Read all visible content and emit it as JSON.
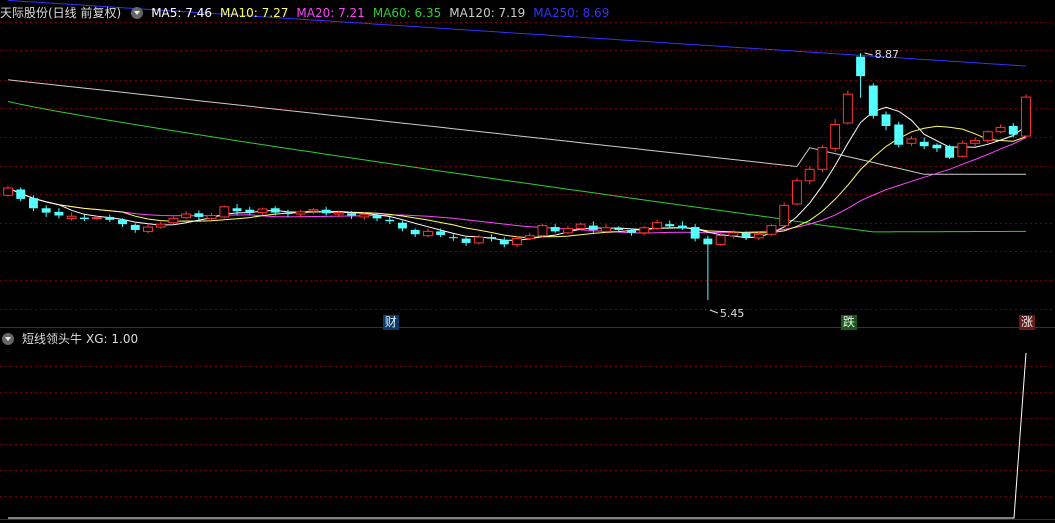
{
  "header": {
    "title": "天际股份(日线 前复权)",
    "ma": [
      {
        "label": "MA5: 7.46",
        "color": "#ffffff"
      },
      {
        "label": "MA10: 7.27",
        "color": "#ffff66"
      },
      {
        "label": "MA20: 7.21",
        "color": "#ff44ff"
      },
      {
        "label": "MA60: 6.35",
        "color": "#33cc33"
      },
      {
        "label": "MA120: 7.19",
        "color": "#cccccc"
      },
      {
        "label": "MA250: 8.69",
        "color": "#3333ff"
      }
    ]
  },
  "indicator": {
    "title": "短线领头牛",
    "value_label": "XG: 1.00"
  },
  "colors": {
    "up": "#ff3333",
    "down": "#54ffff",
    "grid": "#7a0000",
    "background": "#000000",
    "ma5": "#ffffff",
    "ma10": "#ffff66",
    "ma20": "#ff44ff",
    "ma60": "#33cc33",
    "ma120": "#cccccc",
    "ma250": "#3333ff"
  },
  "chart_data": {
    "type": "candlestick",
    "y_range": [
      5.2,
      9.3
    ],
    "candles": [
      [
        6.9,
        7.0,
        7.03,
        6.88
      ],
      [
        6.98,
        6.85,
        7.01,
        6.82
      ],
      [
        6.86,
        6.72,
        6.9,
        6.68
      ],
      [
        6.72,
        6.66,
        6.76,
        6.6
      ],
      [
        6.67,
        6.62,
        6.72,
        6.58
      ],
      [
        6.58,
        6.61,
        6.66,
        6.55
      ],
      [
        6.59,
        6.57,
        6.63,
        6.54
      ],
      [
        6.58,
        6.59,
        6.62,
        6.56
      ],
      [
        6.6,
        6.56,
        6.63,
        6.53
      ],
      [
        6.56,
        6.5,
        6.58,
        6.46
      ],
      [
        6.49,
        6.42,
        6.51,
        6.38
      ],
      [
        6.4,
        6.46,
        6.5,
        6.37
      ],
      [
        6.46,
        6.5,
        6.53,
        6.44
      ],
      [
        6.52,
        6.58,
        6.61,
        6.5
      ],
      [
        6.59,
        6.64,
        6.68,
        6.57
      ],
      [
        6.65,
        6.6,
        6.69,
        6.56
      ],
      [
        6.58,
        6.62,
        6.66,
        6.55
      ],
      [
        6.6,
        6.74,
        6.76,
        6.58
      ],
      [
        6.72,
        6.68,
        6.78,
        6.62
      ],
      [
        6.7,
        6.66,
        6.74,
        6.62
      ],
      [
        6.66,
        6.71,
        6.73,
        6.63
      ],
      [
        6.72,
        6.66,
        6.75,
        6.62
      ],
      [
        6.66,
        6.64,
        6.7,
        6.6
      ],
      [
        6.64,
        6.67,
        6.7,
        6.6
      ],
      [
        6.68,
        6.7,
        6.72,
        6.64
      ],
      [
        6.7,
        6.65,
        6.74,
        6.62
      ],
      [
        6.64,
        6.66,
        6.68,
        6.6
      ],
      [
        6.65,
        6.62,
        6.68,
        6.57
      ],
      [
        6.6,
        6.63,
        6.66,
        6.56
      ],
      [
        6.62,
        6.58,
        6.65,
        6.54
      ],
      [
        6.56,
        6.54,
        6.6,
        6.5
      ],
      [
        6.52,
        6.44,
        6.55,
        6.4
      ],
      [
        6.42,
        6.36,
        6.44,
        6.32
      ],
      [
        6.34,
        6.4,
        6.44,
        6.32
      ],
      [
        6.4,
        6.35,
        6.44,
        6.32
      ],
      [
        6.32,
        6.31,
        6.36,
        6.27
      ],
      [
        6.3,
        6.24,
        6.32,
        6.2
      ],
      [
        6.24,
        6.32,
        6.35,
        6.22
      ],
      [
        6.32,
        6.3,
        6.36,
        6.26
      ],
      [
        6.28,
        6.22,
        6.32,
        6.18
      ],
      [
        6.22,
        6.3,
        6.34,
        6.18
      ],
      [
        6.3,
        6.34,
        6.38,
        6.28
      ],
      [
        6.34,
        6.48,
        6.5,
        6.32
      ],
      [
        6.46,
        6.4,
        6.5,
        6.38
      ],
      [
        6.38,
        6.44,
        6.48,
        6.36
      ],
      [
        6.44,
        6.5,
        6.52,
        6.42
      ],
      [
        6.48,
        6.42,
        6.54,
        6.38
      ],
      [
        6.4,
        6.45,
        6.5,
        6.38
      ],
      [
        6.44,
        6.42,
        6.47,
        6.4
      ],
      [
        6.42,
        6.38,
        6.44,
        6.34
      ],
      [
        6.38,
        6.45,
        6.48,
        6.35
      ],
      [
        6.44,
        6.52,
        6.56,
        6.42
      ],
      [
        6.5,
        6.47,
        6.55,
        6.44
      ],
      [
        6.48,
        6.44,
        6.54,
        6.42
      ],
      [
        6.46,
        6.3,
        6.5,
        6.26
      ],
      [
        6.3,
        6.22,
        6.34,
        5.45
      ],
      [
        6.22,
        6.34,
        6.38,
        6.2
      ],
      [
        6.34,
        6.38,
        6.42,
        6.3
      ],
      [
        6.38,
        6.32,
        6.4,
        6.28
      ],
      [
        6.31,
        6.36,
        6.4,
        6.28
      ],
      [
        6.36,
        6.48,
        6.5,
        6.34
      ],
      [
        6.48,
        6.76,
        6.8,
        6.46
      ],
      [
        6.78,
        7.1,
        7.14,
        6.76
      ],
      [
        7.1,
        7.26,
        7.3,
        7.05
      ],
      [
        7.26,
        7.56,
        7.6,
        7.22
      ],
      [
        7.55,
        7.88,
        7.96,
        7.5
      ],
      [
        7.9,
        8.3,
        8.35,
        7.88
      ],
      [
        8.82,
        8.55,
        8.87,
        8.25
      ],
      [
        8.42,
        8.0,
        8.45,
        7.96
      ],
      [
        8.02,
        7.86,
        8.06,
        7.8
      ],
      [
        7.88,
        7.6,
        7.92,
        7.56
      ],
      [
        7.62,
        7.68,
        7.72,
        7.58
      ],
      [
        7.64,
        7.58,
        7.7,
        7.54
      ],
      [
        7.6,
        7.55,
        7.62,
        7.5
      ],
      [
        7.58,
        7.42,
        7.6,
        7.4
      ],
      [
        7.44,
        7.62,
        7.66,
        7.42
      ],
      [
        7.62,
        7.66,
        7.7,
        7.58
      ],
      [
        7.66,
        7.78,
        7.8,
        7.62
      ],
      [
        7.78,
        7.84,
        7.88,
        7.76
      ],
      [
        7.86,
        7.74,
        7.9,
        7.7
      ],
      [
        7.72,
        8.26,
        8.3,
        7.7
      ]
    ],
    "annotations": {
      "high": {
        "label": "8.87",
        "index": 67,
        "value": 8.87
      },
      "low": {
        "label": "5.45",
        "index": 55,
        "value": 5.45
      }
    },
    "markers": [
      {
        "label": "财",
        "index": 30,
        "color": "#54ffff"
      },
      {
        "label": "跌",
        "index": 66,
        "color": "#33cc33"
      },
      {
        "label": "涨",
        "index": 80,
        "color": "#ff6666"
      }
    ],
    "indicator_series": {
      "name": "XG",
      "y_range": [
        0,
        1
      ],
      "values": [
        0,
        0,
        0,
        0,
        0,
        0,
        0,
        0,
        0,
        0,
        0,
        0,
        0,
        0,
        0,
        0,
        0,
        0,
        0,
        0,
        0,
        0,
        0,
        0,
        0,
        0,
        0,
        0,
        0,
        0,
        0,
        0,
        0,
        0,
        0,
        0,
        0,
        0,
        0,
        0,
        0,
        0,
        0,
        0,
        0,
        0,
        0,
        0,
        0,
        0,
        0,
        0,
        0,
        0,
        0,
        0,
        0,
        0,
        0,
        0,
        0,
        0,
        0,
        0,
        0,
        0,
        0,
        0,
        0,
        0,
        0,
        0,
        0,
        0,
        0,
        0,
        0,
        0,
        0,
        0,
        1
      ]
    }
  }
}
